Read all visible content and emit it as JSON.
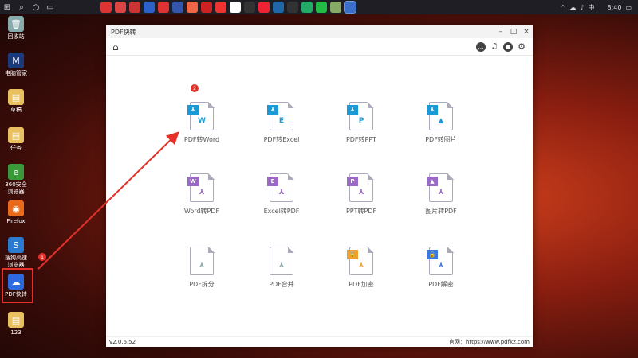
{
  "taskbar": {
    "clock": "8:40",
    "tray": [
      "^",
      "☁",
      "♪",
      "中"
    ],
    "apps": [
      {
        "icon": "start-icon",
        "glyph": "⊞",
        "color": "#1e1e24"
      },
      {
        "icon": "search-icon",
        "glyph": "⌕",
        "color": "#1e1e24"
      },
      {
        "icon": "cortana-icon",
        "glyph": "○",
        "color": "#1e1e24"
      },
      {
        "icon": "task-view-icon",
        "glyph": "▭",
        "color": "#1e1e24"
      }
    ],
    "pinned_colors": [
      "#d33",
      "#d44",
      "#c33",
      "#2a62c9",
      "#d33",
      "#35a",
      "#e64",
      "#c22",
      "#e33",
      "#fff",
      "#333",
      "#e23",
      "#26a",
      "#333",
      "#2a6",
      "#2b4",
      "#8a6",
      "#3c6fc9"
    ]
  },
  "desktop": {
    "icons": [
      {
        "name": "recycle-bin",
        "label": "回收站",
        "glyph": "🗑",
        "color": "#8aa"
      },
      {
        "name": "pc-manager",
        "label": "电脑管家",
        "glyph": "M",
        "color": "#1a3a7a"
      },
      {
        "name": "draft",
        "label": "草稿",
        "glyph": "▤",
        "color": "#e8c060"
      },
      {
        "name": "task",
        "label": "任务",
        "glyph": "▤",
        "color": "#e8c060"
      },
      {
        "name": "browser-360",
        "label": "360安全浏览器",
        "glyph": "e",
        "color": "#3a9a3a"
      },
      {
        "name": "firefox",
        "label": "Firefox",
        "glyph": "◉",
        "color": "#e86a1a"
      },
      {
        "name": "sogou-browser",
        "label": "搜狗高速浏览器",
        "glyph": "S",
        "color": "#2a7ad0"
      },
      {
        "name": "pdf-kuaizhuan",
        "label": "PDF快转",
        "glyph": "☁",
        "color": "#2d6ae0"
      },
      {
        "name": "folder-123",
        "label": "123",
        "glyph": "▤",
        "color": "#e8c060"
      }
    ],
    "badge1": "1"
  },
  "window": {
    "title": "PDF快转",
    "min": "–",
    "max": "□",
    "close": "×",
    "badge2": "2",
    "version": "v2.0.6.52",
    "website": "官网：https://www.pdfkz.com",
    "tiles": [
      {
        "name": "pdf-to-word",
        "label": "PDF转Word",
        "tag": "⅄",
        "tagColor": "#1a9ad6",
        "body": "W",
        "bodyColor": "#1a9ad6"
      },
      {
        "name": "pdf-to-excel",
        "label": "PDF转Excel",
        "tag": "⅄",
        "tagColor": "#1a9ad6",
        "body": "E",
        "bodyColor": "#1a9ad6"
      },
      {
        "name": "pdf-to-ppt",
        "label": "PDF转PPT",
        "tag": "⅄",
        "tagColor": "#1a9ad6",
        "body": "P",
        "bodyColor": "#1a9ad6"
      },
      {
        "name": "pdf-to-image",
        "label": "PDF转图片",
        "tag": "⅄",
        "tagColor": "#1a9ad6",
        "body": "▲",
        "bodyColor": "#1a9ad6"
      },
      {
        "name": "word-to-pdf",
        "label": "Word转PDF",
        "tag": "W",
        "tagColor": "#9a6ac6",
        "body": "⅄",
        "bodyColor": "#9a6ac6"
      },
      {
        "name": "excel-to-pdf",
        "label": "Excel转PDF",
        "tag": "E",
        "tagColor": "#9a6ac6",
        "body": "⅄",
        "bodyColor": "#9a6ac6"
      },
      {
        "name": "ppt-to-pdf",
        "label": "PPT转PDF",
        "tag": "P",
        "tagColor": "#9a6ac6",
        "body": "⅄",
        "bodyColor": "#9a6ac6"
      },
      {
        "name": "image-to-pdf",
        "label": "图片转PDF",
        "tag": "▲",
        "tagColor": "#9a6ac6",
        "body": "⅄",
        "bodyColor": "#9a6ac6"
      },
      {
        "name": "pdf-split",
        "label": "PDF拆分",
        "tag": "",
        "tagColor": "transparent",
        "body": "⅄",
        "bodyColor": "#8aa"
      },
      {
        "name": "pdf-merge",
        "label": "PDF合并",
        "tag": "",
        "tagColor": "transparent",
        "body": "⅄",
        "bodyColor": "#8aa"
      },
      {
        "name": "pdf-encrypt",
        "label": "PDF加密",
        "tag": "🔒",
        "tagColor": "#f0a030",
        "body": "⅄",
        "bodyColor": "#f0a030"
      },
      {
        "name": "pdf-decrypt",
        "label": "PDF解密",
        "tag": "🔓",
        "tagColor": "#3a7ae0",
        "body": "⅄",
        "bodyColor": "#3a7ae0"
      }
    ]
  }
}
